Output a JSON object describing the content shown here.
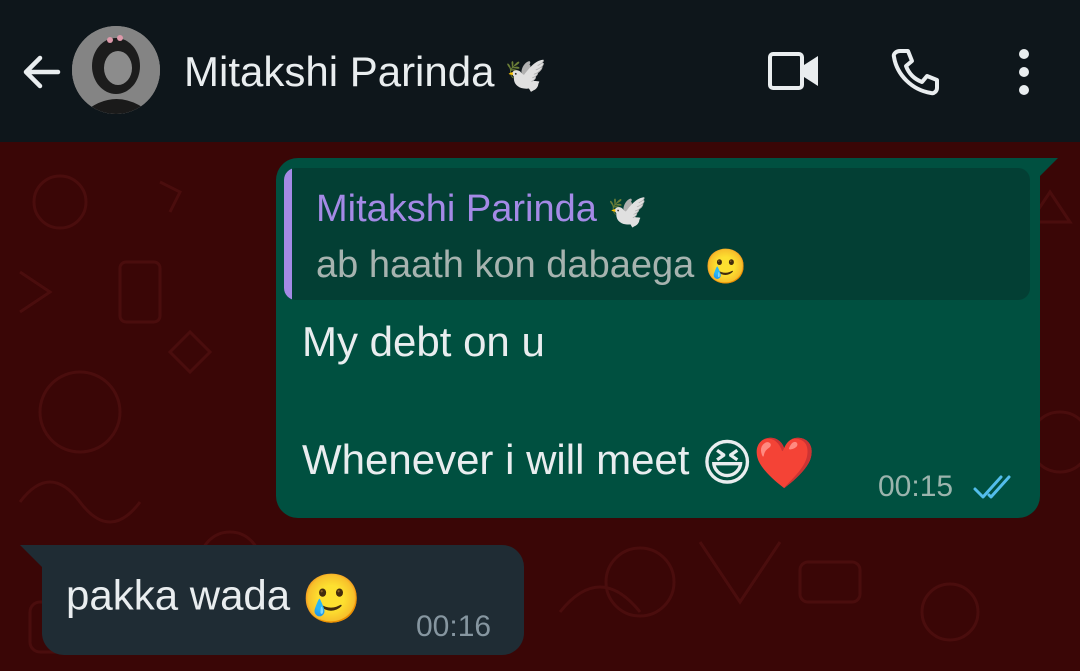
{
  "header": {
    "contact_name": "Mitakshi Parinda",
    "name_emoji": "🕊️",
    "icons": [
      "back-arrow-icon",
      "video-call-icon",
      "voice-call-icon",
      "more-options-icon"
    ]
  },
  "messages": [
    {
      "direction": "outgoing",
      "quoted": {
        "sender": "Mitakshi Parinda",
        "sender_emoji": "🕊️",
        "text": "ab haath kon dabaega",
        "text_emoji": "🥲"
      },
      "line1": "My debt on u",
      "line2": "Whenever i will meet",
      "line2_emoji": "😆❤️",
      "time": "00:15",
      "status": "read"
    },
    {
      "direction": "incoming",
      "text": "pakka wada",
      "emoji": "🥲",
      "time": "00:16"
    }
  ],
  "colors": {
    "header_bg": "#0e161b",
    "wallpaper": "#3a0606",
    "outgoing_bubble": "#005040",
    "incoming_bubble": "#1f2c34",
    "quote_accent": "#a48ae6",
    "read_ticks": "#53bdeb"
  }
}
